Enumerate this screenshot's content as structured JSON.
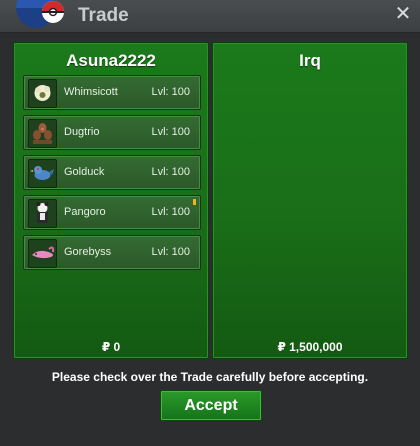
{
  "window": {
    "title": "Trade",
    "close_label": "✕"
  },
  "left_trader": {
    "name": "Asuna2222",
    "money": "₽ 0",
    "pokemon": [
      {
        "name": "Whimsicott",
        "level": "Lvl: 100",
        "held_item": false,
        "icon": "whimsicott-icon"
      },
      {
        "name": "Dugtrio",
        "level": "Lvl: 100",
        "held_item": false,
        "icon": "dugtrio-icon"
      },
      {
        "name": "Golduck",
        "level": "Lvl: 100",
        "held_item": false,
        "icon": "golduck-icon"
      },
      {
        "name": "Pangoro",
        "level": "Lvl: 100",
        "held_item": true,
        "icon": "pangoro-icon"
      },
      {
        "name": "Gorebyss",
        "level": "Lvl: 100",
        "held_item": false,
        "icon": "gorebyss-icon"
      }
    ]
  },
  "right_trader": {
    "name": "Irq",
    "money": "₽ 1,500,000"
  },
  "footer": {
    "message": "Please check over the Trade carefully before accepting.",
    "accept_label": "Accept"
  },
  "colors": {
    "panel_green": "#1b7a1b",
    "slot_green": "#356b33",
    "accept_green": "#2b9a29",
    "background": "#2e3032",
    "held_item_marker": "#f1b21c"
  }
}
